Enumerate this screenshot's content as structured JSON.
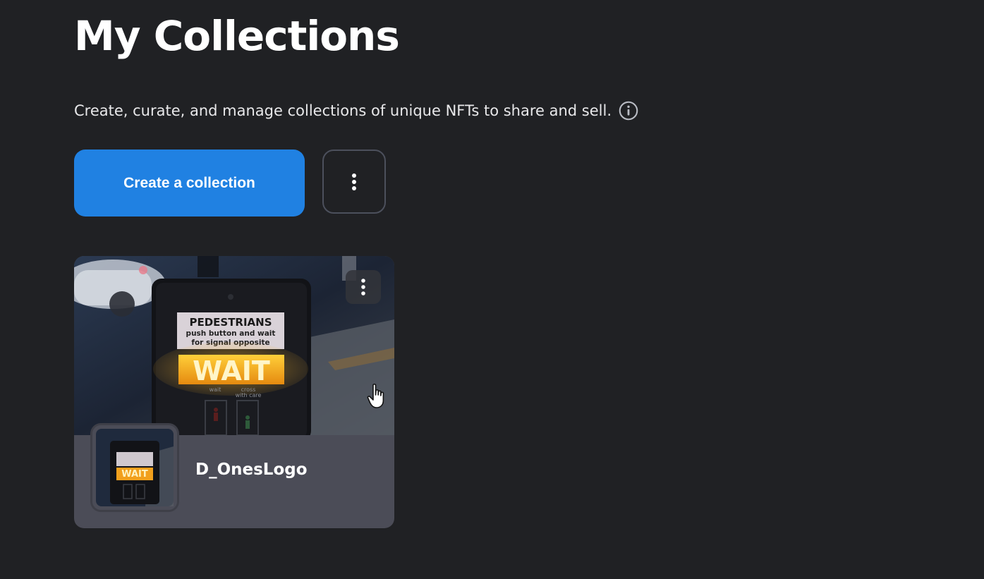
{
  "header": {
    "title": "My Collections",
    "subtitle": "Create, curate, and manage collections of unique NFTs to share and sell."
  },
  "actions": {
    "create_label": "Create a collection"
  },
  "collections": [
    {
      "name": "D_OnesLogo",
      "image_sign": {
        "line1": "PEDESTRIANS",
        "line2": "push button and wait",
        "line3": "for signal opposite",
        "light": "WAIT",
        "caption_left": "wait",
        "caption_right_1": "cross",
        "caption_right_2": "with care"
      }
    }
  ],
  "icons": {
    "info": "info-circle-icon",
    "more": "vertical-dots-icon",
    "cursor": "hand-pointer-icon"
  },
  "colors": {
    "background": "#202124",
    "primary_button": "#2081e2",
    "card_footer": "#4b4c57",
    "sign_light": "#f7a81c"
  }
}
